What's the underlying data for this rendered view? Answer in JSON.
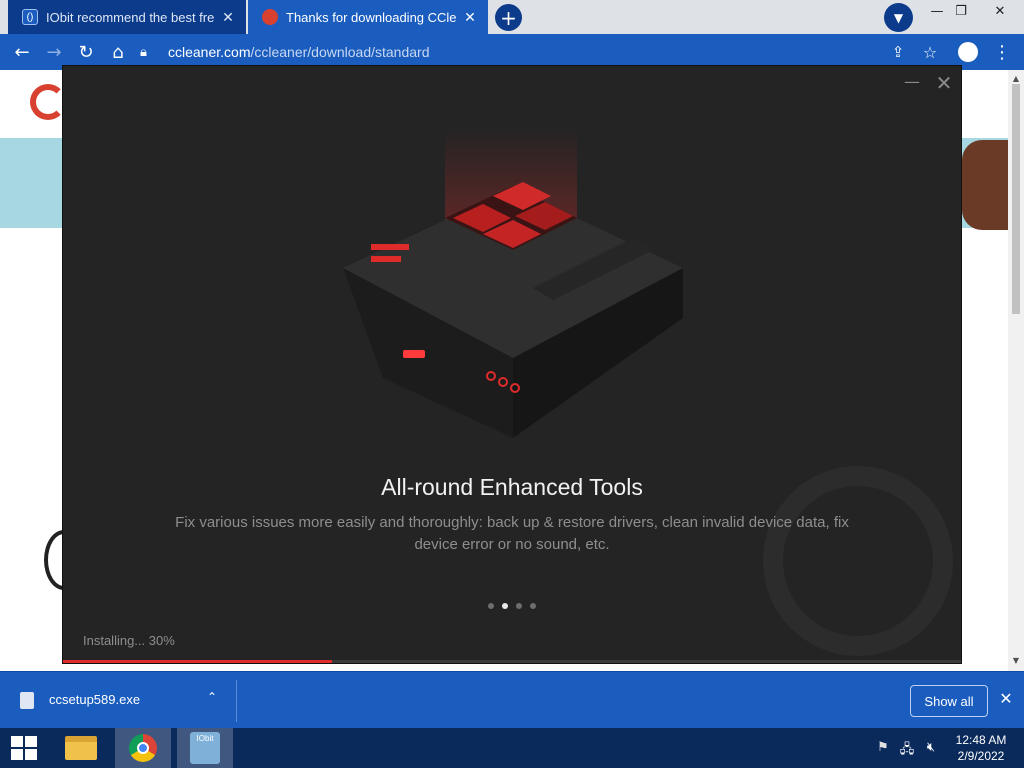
{
  "browser": {
    "tabs": [
      {
        "title": "IObit recommend the best free, f",
        "favicon": "iobit-favicon",
        "active": false
      },
      {
        "title": "Thanks for downloading CCleane",
        "favicon": "ccleaner-favicon",
        "active": true
      }
    ],
    "url_host": "ccleaner.com",
    "url_path": "/ccleaner/download/standard"
  },
  "installer": {
    "slide_title": "All-round Enhanced Tools",
    "slide_description": "Fix various issues more easily and thoroughly: back up & restore drivers, clean invalid device data, fix device error or no sound, etc.",
    "status_text": "Installing... 30%",
    "progress": 0.3,
    "slides_total": 4,
    "slide_active_index": 1,
    "accent_color": "#e02b2b"
  },
  "download_bar": {
    "file_name": "ccsetup589.exe",
    "show_all_label": "Show all"
  },
  "taskbar": {
    "time": "12:48 AM",
    "date": "2/9/2022"
  },
  "colors": {
    "browser_accent": "#1a5dbf",
    "dialog_background": "#242424"
  }
}
